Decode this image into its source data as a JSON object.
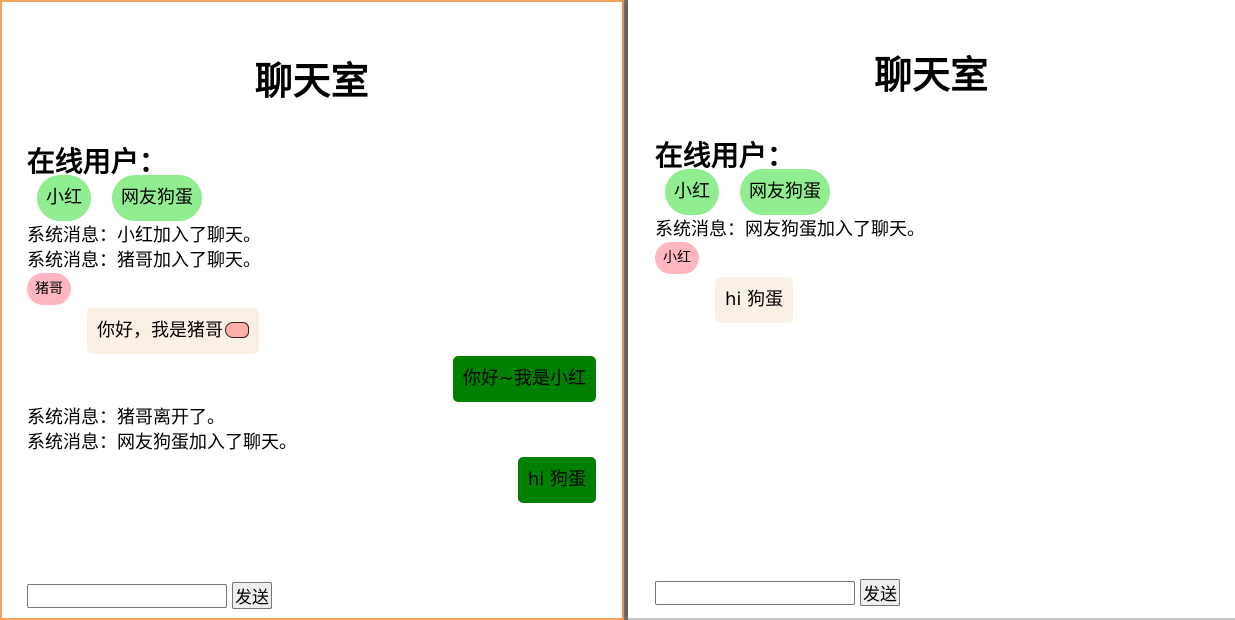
{
  "left_window": {
    "title": "聊天室",
    "online_heading": "在线用户：",
    "online_users": [
      "小红",
      "网友狗蛋"
    ],
    "sys_msg_1": "系统消息：小红加入了聊天。",
    "sys_msg_2": "系统消息：猪哥加入了聊天。",
    "sender_1": "猪哥",
    "incoming_1": "你好，我是猪哥",
    "incoming_1_emoji": "pig-icon",
    "outgoing_1": "你好~我是小红",
    "sys_msg_3": "系统消息：猪哥离开了。",
    "sys_msg_4": "系统消息：网友狗蛋加入了聊天。",
    "outgoing_2": "hi 狗蛋",
    "input_value": "",
    "send_label": "发送"
  },
  "right_window": {
    "title": "聊天室",
    "online_heading": "在线用户：",
    "online_users": [
      "小红",
      "网友狗蛋"
    ],
    "sys_msg_1": "系统消息：网友狗蛋加入了聊天。",
    "sender_1": "小红",
    "incoming_1": "hi 狗蛋",
    "input_value": "",
    "send_label": "发送"
  },
  "colors": {
    "online_pill": "#90ee90",
    "sender_badge": "#ffb6c1",
    "incoming_bubble": "#faf0e6",
    "outgoing_bubble": "#008000",
    "left_window_border": "#f3a35f"
  }
}
